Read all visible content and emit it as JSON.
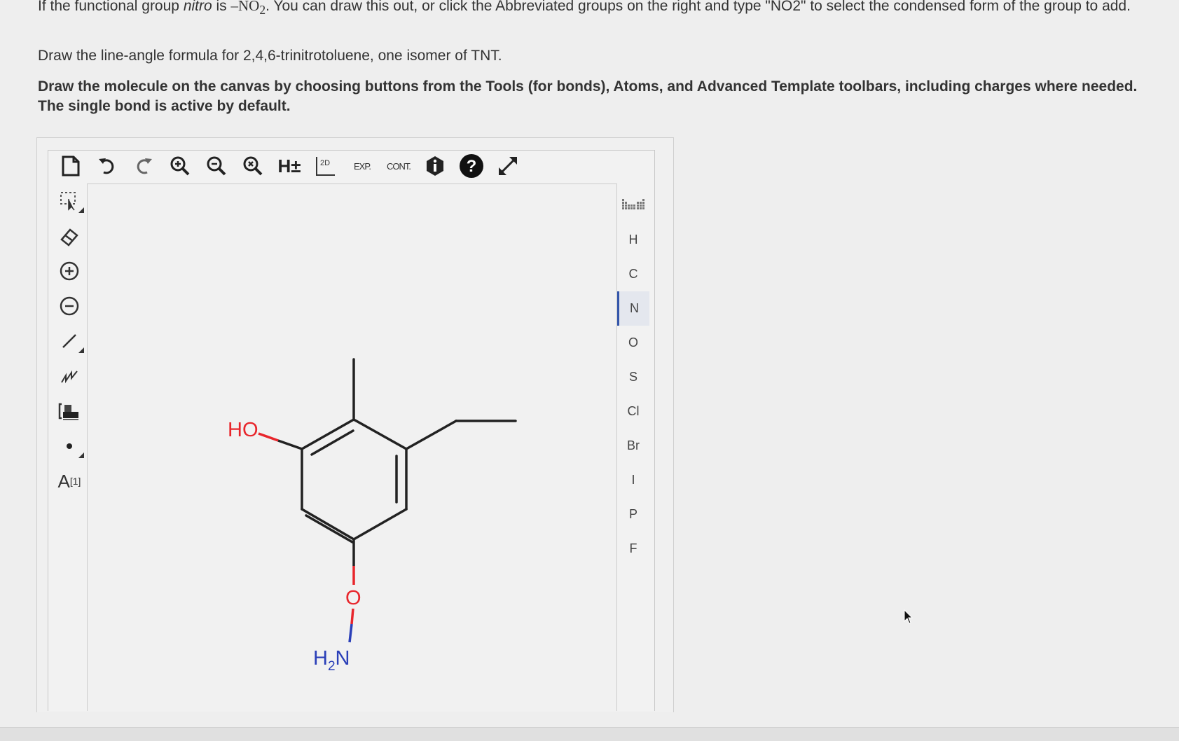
{
  "question": {
    "intro_part1": "If the functional group ",
    "intro_nitro": "nitro",
    "intro_part2": " is ",
    "intro_formula": "–NO",
    "intro_formula_sub": "2",
    "intro_part3": ". You can draw this out, or click the Abbreviated groups on the right and type \"NO2\" to select the condensed form of the group to add.",
    "prompt": "Draw the line-angle formula for 2,4,6-trinitrotoluene, one isomer of TNT.",
    "instructions": "Draw the molecule on the canvas by choosing buttons from the Tools (for bonds), Atoms, and Advanced Template toolbars, including charges where needed. The single bond is active by default."
  },
  "toolbar": {
    "h_toggle": "H±",
    "clean2d": "2D",
    "expand": "EXP.",
    "contract": "CONT."
  },
  "left_tools": {
    "isotope_label": "A",
    "isotope_sup": "[1]"
  },
  "atoms": [
    "H",
    "C",
    "N",
    "O",
    "S",
    "Cl",
    "Br",
    "I",
    "P",
    "F"
  ],
  "selected_atom": "N",
  "molecule": {
    "labels": {
      "ho": "HO",
      "o": "O",
      "h2n_h": "H",
      "h2n_sub": "2",
      "h2n_n": "N"
    },
    "colors": {
      "bond": "#222222",
      "oxygen": "#e8262c",
      "nitrogen": "#2a3fb8"
    }
  }
}
